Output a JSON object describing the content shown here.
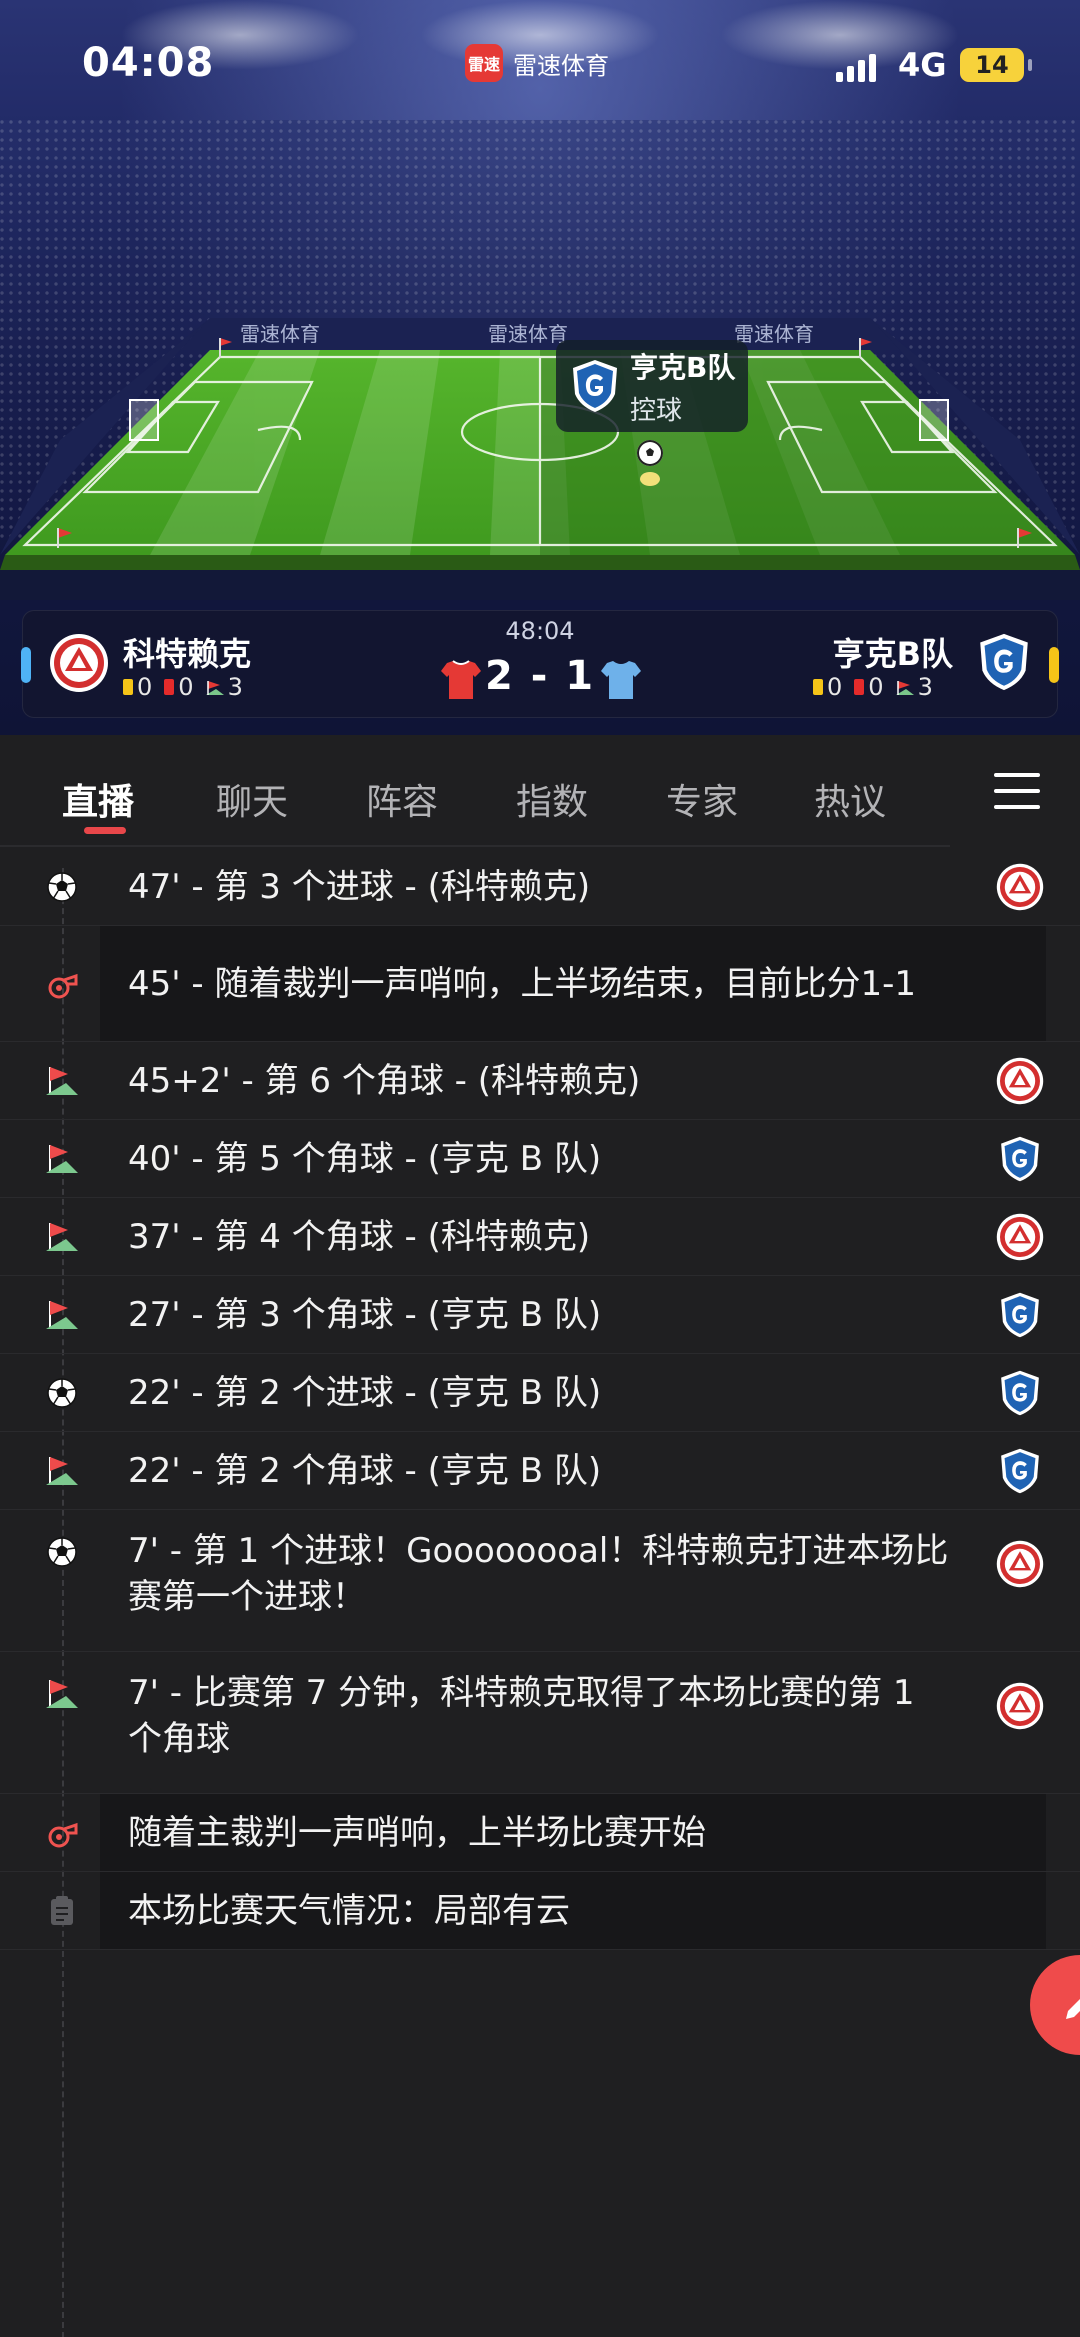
{
  "status_bar": {
    "time": "04:08",
    "app_name": "雷速体育",
    "app_logo_text": "雷速",
    "network": "4G",
    "battery": "14"
  },
  "pitch": {
    "ad_text": "雷速体育",
    "possession_team": "亨克B队",
    "possession_label": "控球"
  },
  "scoreboard": {
    "match_clock": "48:04",
    "score": "2 - 1",
    "home": {
      "name": "科特赖克",
      "yellow": "0",
      "red": "0",
      "corners": "3",
      "color": "#e53935",
      "tab_color": "#4fb3f6"
    },
    "away": {
      "name": "亨克B队",
      "yellow": "0",
      "red": "0",
      "corners": "3",
      "color": "#5ca7e6",
      "tab_color": "#f5c418"
    }
  },
  "tabs": [
    {
      "label": "直播",
      "active": true
    },
    {
      "label": "聊天"
    },
    {
      "label": "阵容"
    },
    {
      "label": "指数"
    },
    {
      "label": "专家"
    },
    {
      "label": "热议"
    }
  ],
  "events": [
    {
      "type": "goal-icon",
      "text": "47' - 第 3 个进球 - (科特赖克)",
      "team": "home"
    },
    {
      "type": "whistle-icon",
      "text": "45' - 随着裁判一声哨响，上半场结束，目前比分1-1",
      "team": ""
    },
    {
      "type": "corner-flag-icon",
      "text": "45+2' - 第 6 个角球 - (科特赖克)",
      "team": "home"
    },
    {
      "type": "corner-flag-icon",
      "text": "40' - 第 5 个角球 - (亨克 B 队)",
      "team": "away"
    },
    {
      "type": "corner-flag-icon",
      "text": "37' - 第 4 个角球 - (科特赖克)",
      "team": "home"
    },
    {
      "type": "corner-flag-icon",
      "text": "27' - 第 3 个角球 - (亨克 B 队)",
      "team": "away"
    },
    {
      "type": "goal-icon",
      "text": "22' - 第 2 个进球 - (亨克 B 队)",
      "team": "away"
    },
    {
      "type": "corner-flag-icon",
      "text": "22' - 第 2 个角球 - (亨克 B 队)",
      "team": "away"
    },
    {
      "type": "goal-icon",
      "text": "7' - 第 1 个进球！Goooooooal！科特赖克打进本场比赛第一个进球！",
      "team": "home"
    },
    {
      "type": "corner-flag-icon",
      "text": "7' - 比赛第 7 分钟，科特赖克取得了本场比赛的第 1 个角球",
      "team": "home"
    },
    {
      "type": "whistle-icon",
      "text": "随着主裁判一声哨响，上半场比赛开始",
      "team": ""
    },
    {
      "type": "clipboard-icon",
      "text": "本场比赛天气情况：局部有云",
      "team": ""
    }
  ]
}
